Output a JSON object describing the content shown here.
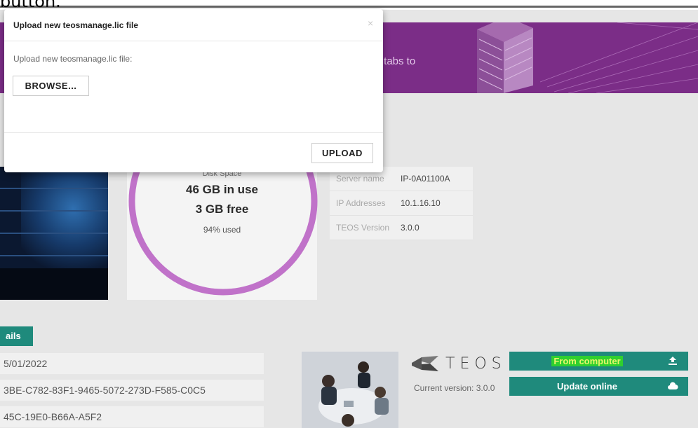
{
  "caption": "button.",
  "banner": {
    "text": "r tabs to",
    "accent_color": "#7b2d87"
  },
  "disk": {
    "label": "Disk Space",
    "in_use": "46 GB in use",
    "free": "3 GB free",
    "used_pct": "94% used",
    "used_fraction": 0.94,
    "ring_color": "#c072c9"
  },
  "server_info": [
    {
      "key": "Server name",
      "value": "IP-0A01100A"
    },
    {
      "key": "IP Addresses",
      "value": "10.1.16.10"
    },
    {
      "key": "TEOS Version",
      "value": "3.0.0"
    }
  ],
  "details": {
    "tab_label": "ails",
    "lines": [
      "5/01/2022",
      "3BE-C782-83F1-9465-5072-273D-F585-C0C5",
      "45C-19E0-B66A-A5F2"
    ]
  },
  "teos": {
    "brand": "TEOS",
    "current_version": "Current version: 3.0.0"
  },
  "buttons": {
    "from_computer": "From computer",
    "update_online": "Update online",
    "from_computer_icon": "upload-icon",
    "update_online_icon": "cloud-icon",
    "green_color": "#1f8a7c"
  },
  "modal": {
    "title": "Upload new teosmanage.lic file",
    "close_glyph": "×",
    "body_label": "Upload new teosmanage.lic file:",
    "browse_label": "BROWSE...",
    "upload_label": "UPLOAD"
  }
}
